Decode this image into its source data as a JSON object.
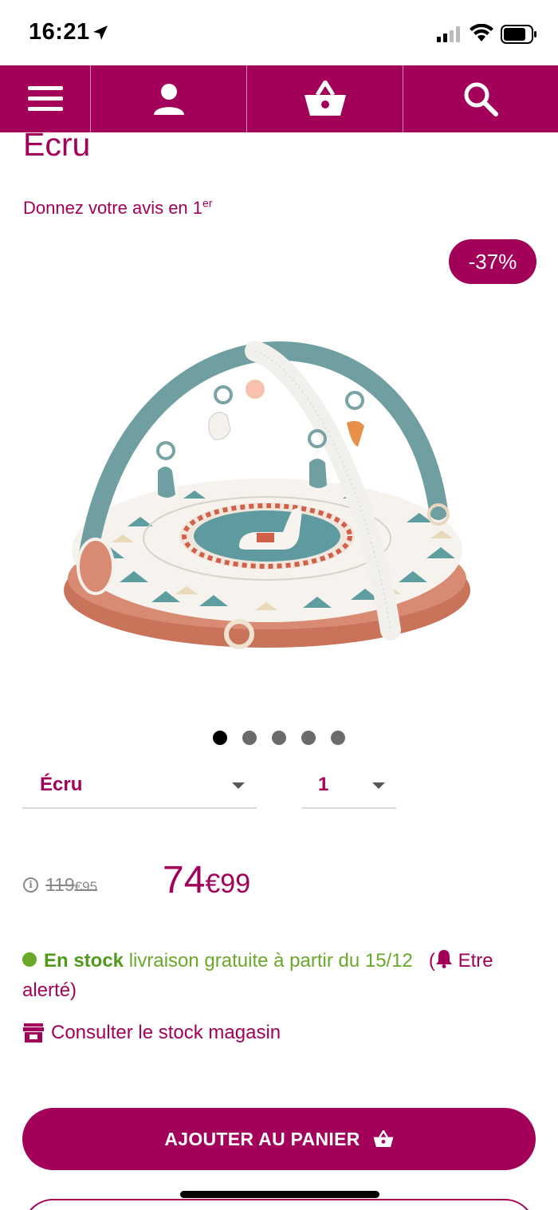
{
  "status_bar": {
    "time": "16:21"
  },
  "navbar": {
    "icons": [
      "menu-icon",
      "account-icon",
      "basket-icon",
      "search-icon"
    ],
    "background": "#a3005a"
  },
  "product": {
    "title": "Portique tapis d'éveil Lama Sacha Écru",
    "review_prefix": "Donnez votre avis en 1",
    "review_sup": "er",
    "discount": "-37%",
    "carousel": {
      "count": 5,
      "active": 1
    }
  },
  "selectors": {
    "color": "Écru",
    "quantity": "1"
  },
  "price": {
    "old_int": "119",
    "old_cents": "€95",
    "new_int": "74",
    "new_cents": "€99"
  },
  "stock": {
    "status": "En stock",
    "delivery": "livraison gratuite à partir du 15/12",
    "alert_open": "(",
    "alert_text": "Etre alerté)",
    "store_link": "Consulter le stock magasin"
  },
  "buttons": {
    "add_to_cart": "AJOUTER AU PANIER"
  },
  "colors": {
    "brand": "#a3005a",
    "stock_green": "#6aa82a"
  }
}
